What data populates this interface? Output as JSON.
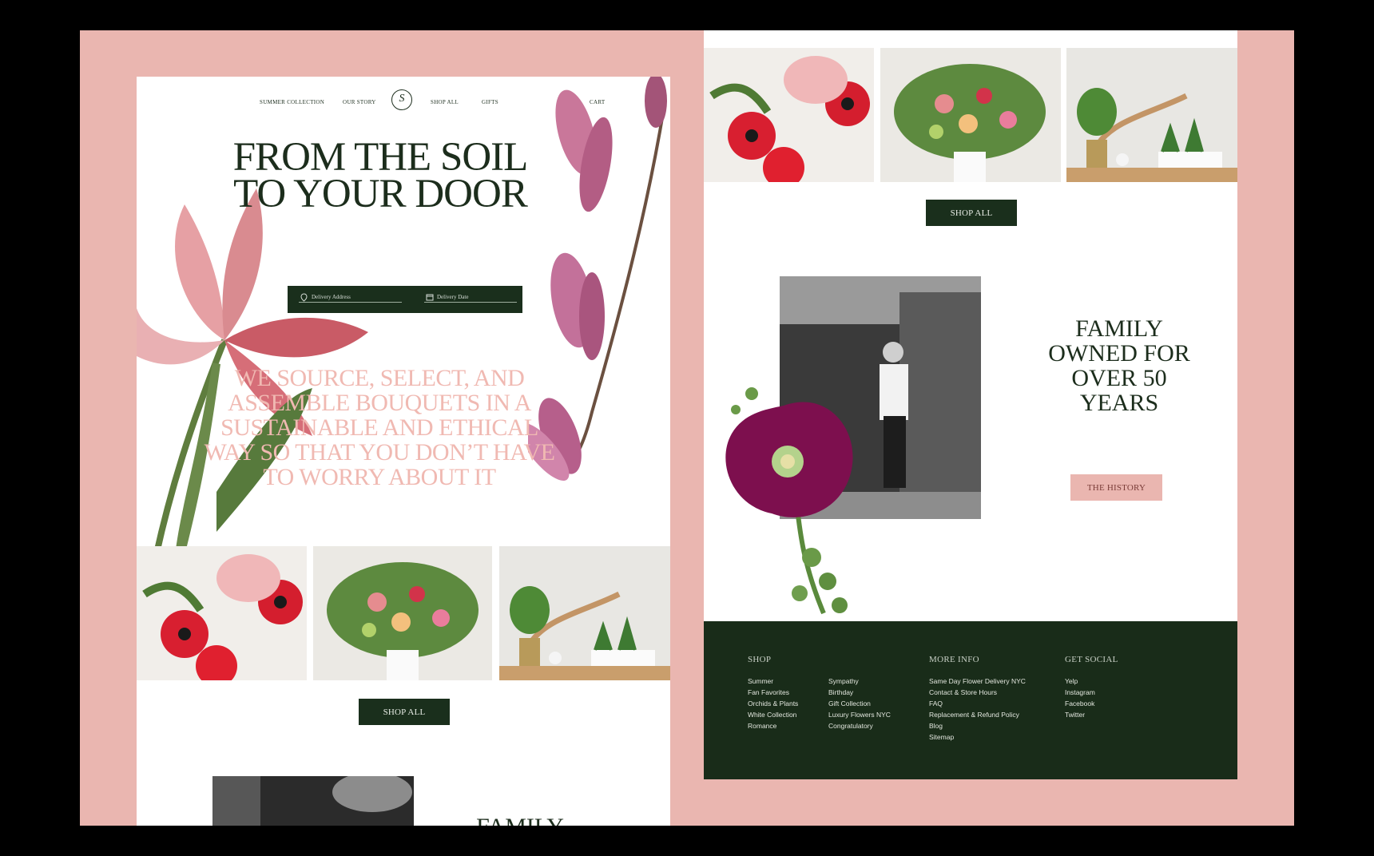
{
  "colors": {
    "pink": "#eab6b0",
    "forest": "#1a2f1c",
    "blush_text": "#f0b9b2"
  },
  "nav": {
    "summer": "SUMMER COLLECTION",
    "story": "OUR STORY",
    "logo": "S",
    "shop": "SHOP ALL",
    "gifts": "GIFTS",
    "cart": "CART"
  },
  "hero": {
    "title": "FROM THE SOIL TO YOUR DOOR"
  },
  "search": {
    "address_placeholder": "Delivery Address",
    "date_placeholder": "Delivery Date"
  },
  "tagline": "WE SOURCE, SELECT, AND ASSEMBLE BOUQUETS IN A SUSTAINABLE AND ETHICAL WAY SO THAT YOU DON’T HAVE TO WORRY ABOUT IT",
  "shop_all_label": "SHOP ALL",
  "history": {
    "title": "FAMILY OWNED FOR OVER 50 YEARS",
    "partial_title": "FAMILY",
    "button": "THE HISTORY"
  },
  "footer": {
    "shop_heading": "SHOP",
    "shop_col1": [
      "Summer",
      "Fan Favorites",
      "Orchids & Plants",
      "White Collection",
      "Romance"
    ],
    "shop_col2": [
      "Sympathy",
      "Birthday",
      "Gift Collection",
      "Luxury Flowers NYC",
      "Congratulatory"
    ],
    "more_heading": "MORE INFO",
    "more_links": [
      "Same Day Flower Delivery NYC",
      "Contact & Store Hours",
      "FAQ",
      "Replacement & Refund Policy",
      "Blog",
      "Sitemap"
    ],
    "social_heading": "GET SOCIAL",
    "social_links": [
      "Yelp",
      "Instagram",
      "Facebook",
      "Twitter"
    ]
  }
}
